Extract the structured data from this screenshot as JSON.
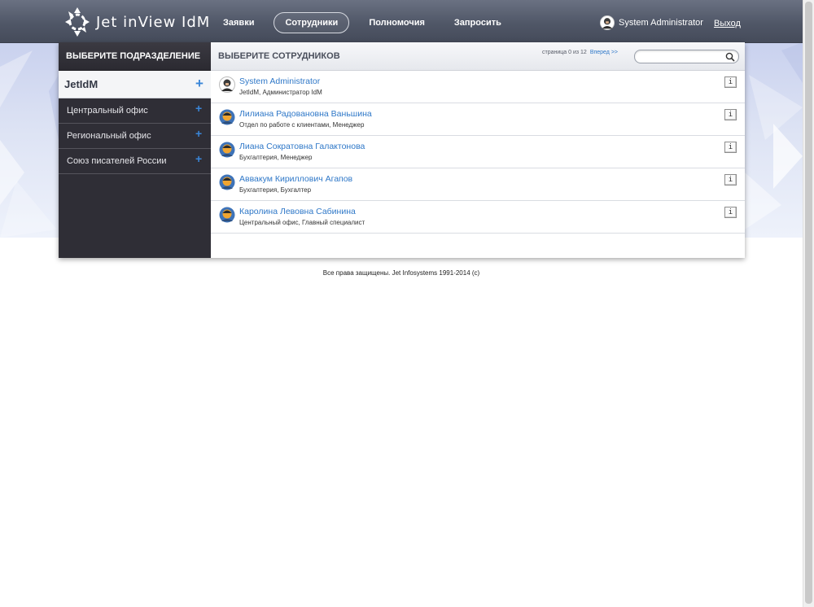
{
  "header": {
    "brand": "Jet inView IdM",
    "nav": [
      {
        "label": "Заявки",
        "active": false
      },
      {
        "label": "Сотрудники",
        "active": true
      },
      {
        "label": "Полномочия",
        "active": false
      },
      {
        "label": "Запросить",
        "active": false
      }
    ],
    "user_name": "System Administrator",
    "logout_label": "Выход"
  },
  "sidebar": {
    "title": "ВЫБЕРИТЕ ПОДРАЗДЕЛЕНИЕ",
    "root": "JetIdM",
    "items": [
      {
        "label": "Центральный офис"
      },
      {
        "label": "Региональный офис"
      },
      {
        "label": "Союз писателей России"
      }
    ]
  },
  "main": {
    "title": "ВЫБЕРИТЕ СОТРУДНИКОВ",
    "pager_text": "страница 0 из 12",
    "pager_next": "Вперед >>",
    "search_value": "",
    "info_label": "i",
    "employees": [
      {
        "name": "System Administrator",
        "details": "JetIdM, Администратор IdM",
        "avatar": "admin"
      },
      {
        "name": "Лилиана Радовановна Ваньшина",
        "details": "Отдел по работе с клиентами, Менеджер",
        "avatar": "user"
      },
      {
        "name": "Лиана Сократовна Галактонова",
        "details": "Бухгалтерия, Менеджер",
        "avatar": "user"
      },
      {
        "name": "Аввакум Кириллович Агапов",
        "details": "Бухгалтерия, Бухгалтер",
        "avatar": "user"
      },
      {
        "name": "Каролина Левовна Сабинина",
        "details": "Центральный офис, Главный специалист",
        "avatar": "user"
      }
    ]
  },
  "footer": {
    "copyright": "Все права защищены. Jet Infosystems 1991-2014 (c)"
  },
  "colors": {
    "header_bg": "#505767",
    "sidebar_bg": "#2f2e36",
    "link": "#2f78c8",
    "plus": "#3a86d8"
  }
}
